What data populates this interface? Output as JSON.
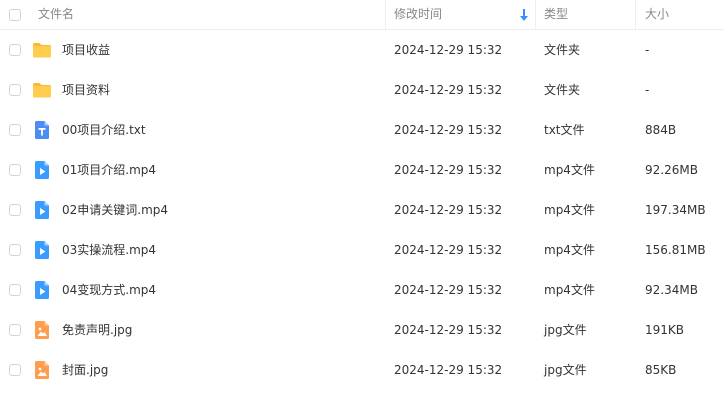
{
  "columns": {
    "name": "文件名",
    "modified": "修改时间",
    "type": "类型",
    "size": "大小"
  },
  "sort": {
    "column": "修改时间",
    "direction": "descending",
    "icon": "sort-down-arrow-icon"
  },
  "colors": {
    "accent": "#3b8cff",
    "folder": "#ffc63d",
    "video": "#3b9cff",
    "text_file": "#4d8bf5",
    "image": "#ff9d4d"
  },
  "files": [
    {
      "icon": "folder-icon",
      "name": "项目收益",
      "modified": "2024-12-29 15:32",
      "type": "文件夹",
      "size": "-"
    },
    {
      "icon": "folder-icon",
      "name": "项目资料",
      "modified": "2024-12-29 15:32",
      "type": "文件夹",
      "size": "-"
    },
    {
      "icon": "txt-file-icon",
      "name": "00项目介绍.txt",
      "modified": "2024-12-29 15:32",
      "type": "txt文件",
      "size": "884B"
    },
    {
      "icon": "video-file-icon",
      "name": "01项目介绍.mp4",
      "modified": "2024-12-29 15:32",
      "type": "mp4文件",
      "size": "92.26MB"
    },
    {
      "icon": "video-file-icon",
      "name": "02申请关键词.mp4",
      "modified": "2024-12-29 15:32",
      "type": "mp4文件",
      "size": "197.34MB"
    },
    {
      "icon": "video-file-icon",
      "name": "03实操流程.mp4",
      "modified": "2024-12-29 15:32",
      "type": "mp4文件",
      "size": "156.81MB"
    },
    {
      "icon": "video-file-icon",
      "name": "04变现方式.mp4",
      "modified": "2024-12-29 15:32",
      "type": "mp4文件",
      "size": "92.34MB"
    },
    {
      "icon": "image-file-icon",
      "name": "免责声明.jpg",
      "modified": "2024-12-29 15:32",
      "type": "jpg文件",
      "size": "191KB"
    },
    {
      "icon": "image-file-icon",
      "name": "封面.jpg",
      "modified": "2024-12-29 15:32",
      "type": "jpg文件",
      "size": "85KB"
    }
  ]
}
